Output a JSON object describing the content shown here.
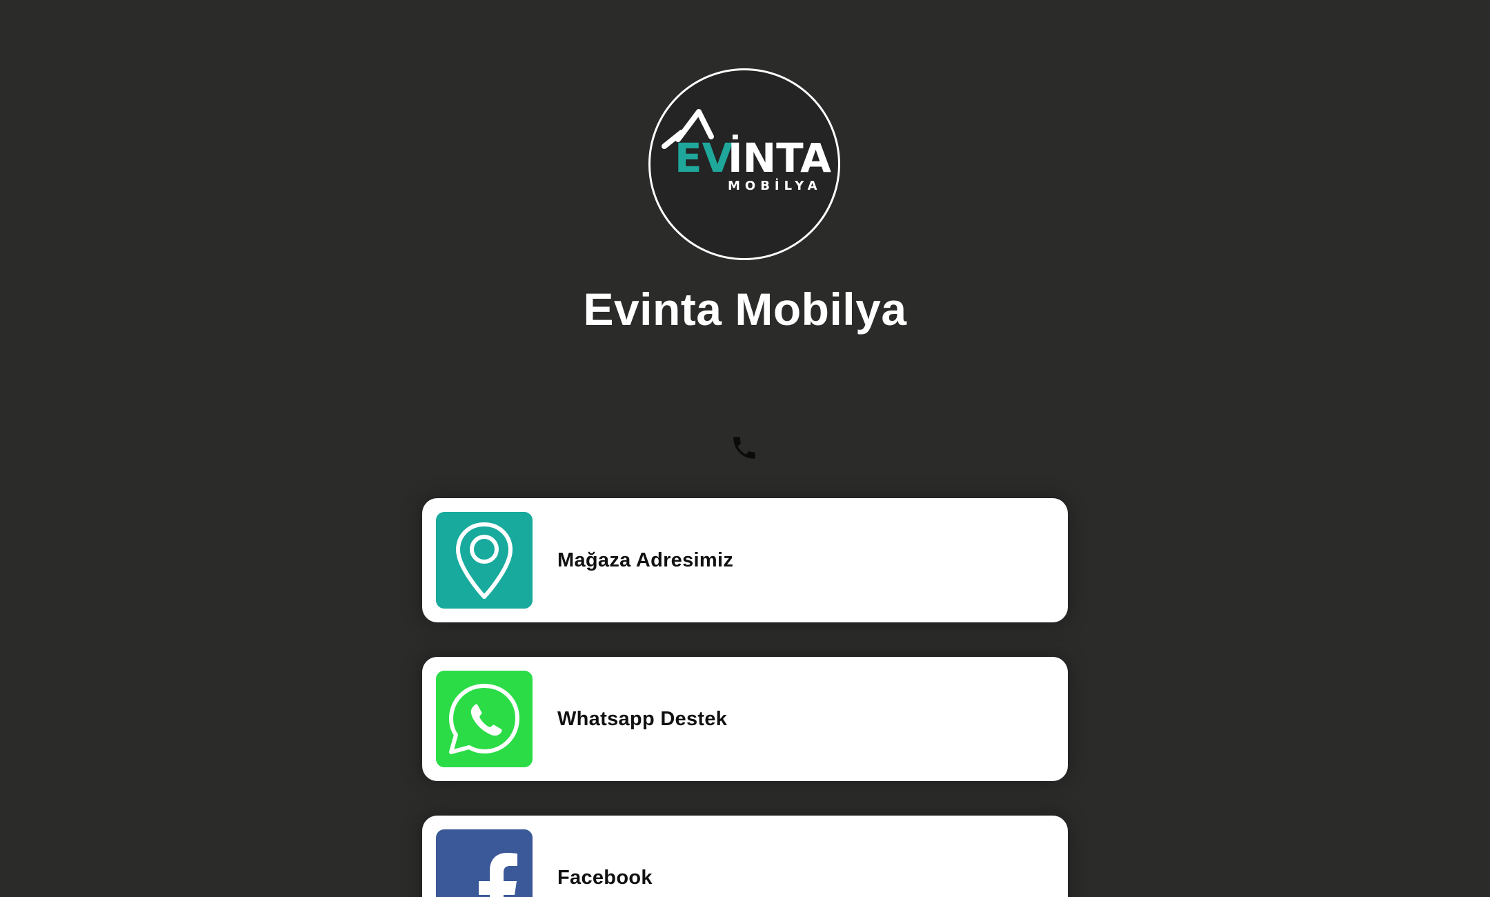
{
  "profile": {
    "name": "Evinta Mobilya",
    "logo": {
      "brand_part_1": "EV",
      "brand_part_2": "İNTA",
      "subtitle": "MOBİLYA",
      "accent_color": "#1ea79a"
    }
  },
  "contact": {
    "phone_icon": "phone-icon"
  },
  "links": [
    {
      "label": "Mağaza Adresimiz",
      "icon": "location-pin-icon",
      "icon_bg": "#17aa9d"
    },
    {
      "label": "Whatsapp Destek",
      "icon": "whatsapp-icon",
      "icon_bg": "#2bdc47"
    },
    {
      "label": "Facebook",
      "icon": "facebook-icon",
      "icon_bg": "#3b5998"
    }
  ],
  "colors": {
    "background": "#2b2b2a",
    "card": "#ffffff",
    "text_primary": "#ffffff"
  }
}
